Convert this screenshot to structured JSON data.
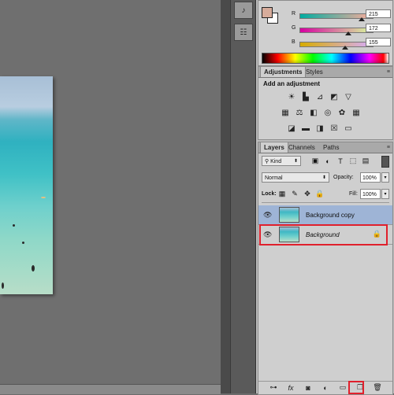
{
  "color_panel": {
    "r_label": "R",
    "r_value": "215",
    "g_label": "G",
    "g_value": "172",
    "b_label": "B",
    "b_value": "155",
    "fg_color": "#d7ac9b"
  },
  "adjustments_panel": {
    "tabs": [
      "Adjustments",
      "Styles"
    ],
    "title": "Add an adjustment"
  },
  "layers_panel": {
    "tabs": [
      "Layers",
      "Channels",
      "Paths"
    ],
    "kind_label": "Kind",
    "blend_mode": "Normal",
    "opacity_label": "Opacity:",
    "opacity_value": "100%",
    "lock_label": "Lock:",
    "fill_label": "Fill:",
    "fill_value": "100%",
    "layers": [
      {
        "name": "Background copy",
        "selected": true
      },
      {
        "name": "Background",
        "selected": false,
        "locked": true
      }
    ]
  },
  "highlight_color": "#e0202c"
}
